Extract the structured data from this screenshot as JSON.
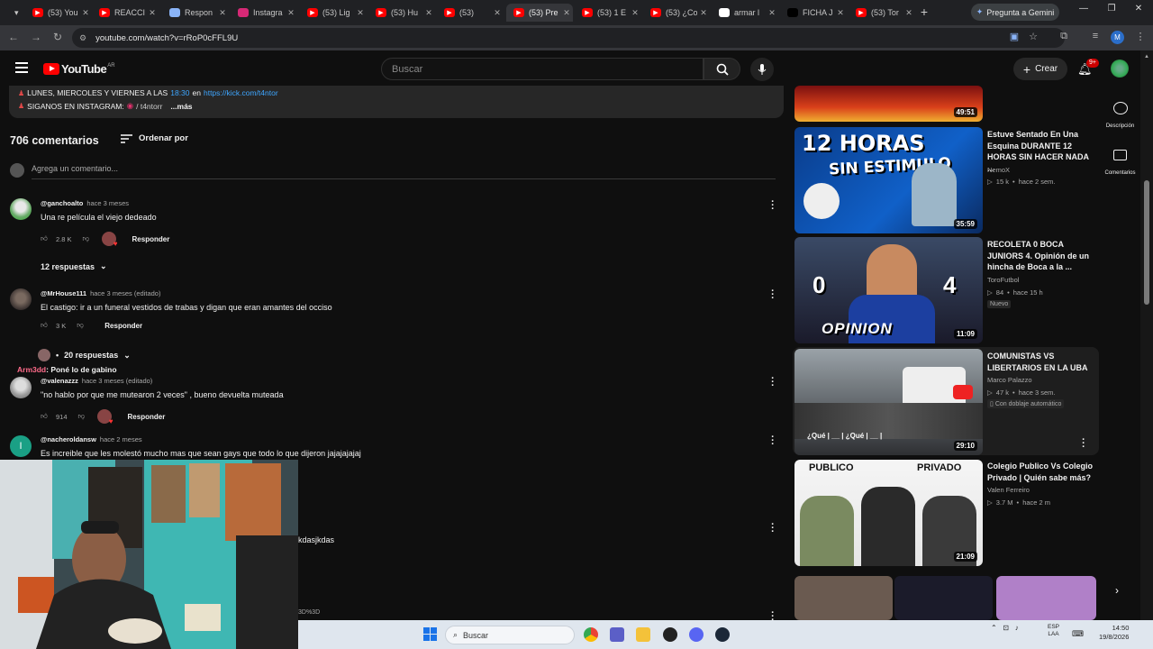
{
  "browser": {
    "tabs": [
      {
        "label": "(53) You",
        "icon": "youtube-icon",
        "color": "#ff0000"
      },
      {
        "label": "REACCI",
        "icon": "youtube-icon",
        "color": "#ff0000"
      },
      {
        "label": "Respon",
        "icon": "gemini-icon",
        "color": "#8ab4f8"
      },
      {
        "label": "Instagra",
        "icon": "instagram-icon",
        "color": "#d62976"
      },
      {
        "label": "(53) Lig",
        "icon": "youtube-icon",
        "color": "#ff0000"
      },
      {
        "label": "(53) Hu",
        "icon": "youtube-icon",
        "color": "#ff0000"
      },
      {
        "label": "(53) ",
        "icon": "youtube-icon",
        "color": "#ff0000"
      },
      {
        "label": "(53) Pre",
        "icon": "youtube-icon",
        "color": "#ff0000",
        "active": true
      },
      {
        "label": "(53) 1 E",
        "icon": "youtube-icon",
        "color": "#ff0000"
      },
      {
        "label": "(53) ¿Co",
        "icon": "youtube-icon",
        "color": "#ff0000"
      },
      {
        "label": "armar l",
        "icon": "google-icon",
        "color": "#ffffff"
      },
      {
        "label": "FICHA J",
        "icon": "tiktok-icon",
        "color": "#000000"
      },
      {
        "label": "(53) Tor",
        "icon": "youtube-icon",
        "color": "#ff0000"
      }
    ],
    "new_tab": "+",
    "gemini_button": "Pregunta a Gemini",
    "url": "youtube.com/watch?v=rRoP0cFFL9U",
    "profile_initial": "M"
  },
  "youtube": {
    "logo_text": "YouTube",
    "logo_country": "AR",
    "search_placeholder": "Buscar",
    "create_label": "Crear",
    "notif_count": "9+"
  },
  "description": {
    "line1_prefix": "LUNES, MIERCOLES Y VIERNES A LAS",
    "line1_time": "18:30",
    "line1_mid": "en",
    "line1_link": "https://kick.com/t4ntor",
    "line2_prefix": "SIGANOS EN INSTAGRAM:",
    "line2_handle": "/ t4ntorr",
    "more": "...más"
  },
  "comments": {
    "count": "706 comentarios",
    "sort_label": "Ordenar por",
    "add_placeholder": "Agrega un comentario...",
    "reply_label": "Responder",
    "items": [
      {
        "user": "@ganchoalto",
        "meta": "hace 3 meses",
        "text": "Una re película el viejo dedeado",
        "likes": "2.8 K",
        "replies": "12 respuestas"
      },
      {
        "user": "@MrHouse111",
        "meta": "hace 3 meses (editado)",
        "text": "El castigo: ir a un funeral vestidos de trabas y digan que eran amantes del occiso",
        "likes": "3 K",
        "replies": "20 respuestas"
      },
      {
        "user": "@valenazzz",
        "meta": "hace 3 meses (editado)",
        "text": "\"no hablo por que me mutearon 2 veces\" , bueno devuelta muteada",
        "likes": "914"
      },
      {
        "user": "@nacheroldansw",
        "meta": "hace 2 meses",
        "text": "Es increible que les molestó mucho mas que sean gays que todo lo que dijeron jajajajajaj"
      }
    ],
    "overlay_user": "Arm3dd",
    "overlay_text": ": Poné lo de gabino",
    "peek_text": "kdasjkdas",
    "peek_text2": "3D%3D"
  },
  "sidebar": {
    "videos": [
      {
        "duration": "49:51"
      },
      {
        "title": "Estuve Sentado En Una Esquina DURANTE 12 HORAS SIN HACER NADA ...",
        "channel": "NemoX",
        "views": "15 k",
        "age": "hace 2 sem.",
        "duration": "35:59",
        "thumb_text1": "12 HORAS",
        "thumb_text2": "SIN ESTIMULO"
      },
      {
        "title": "RECOLETA 0 BOCA JUNIORS 4. Opinión de un hincha de Boca a la ...",
        "channel": "ToroFutbol",
        "views": "84",
        "age": "hace 15 h",
        "badge": "Nuevo",
        "duration": "11:09",
        "thumb_text1": "OPINION",
        "thumb_score_left": "0",
        "thumb_score_right": "4"
      },
      {
        "title": "COMUNISTAS VS LIBERTARIOS EN LA UBA",
        "channel": "Marco Palazzo",
        "views": "47 k",
        "age": "hace 3 sem.",
        "badge": "Con doblaje automático",
        "duration": "29:10",
        "thumb_text1": "¿Qué | __ | ¿Qué | __ |"
      },
      {
        "title": "Colegio Publico Vs Colegio Privado | Quién sabe más?",
        "channel": "Valen Ferreiro",
        "views": "3.7 M",
        "age": "hace 2 m",
        "duration": "21:09",
        "thumb_text1": "PUBLICO",
        "thumb_text2": "PRIVADO"
      }
    ]
  },
  "right_panel": {
    "descripcion": "Descripción",
    "comentarios": "Comentarios"
  },
  "taskbar": {
    "search": "Buscar",
    "lang1": "ESP",
    "lang2": "LAA",
    "time": "14:50",
    "date": "19/8/2026"
  },
  "colors": {
    "accent": "#ff0000",
    "link": "#3ea6ff",
    "bg": "#0f0f0f"
  }
}
